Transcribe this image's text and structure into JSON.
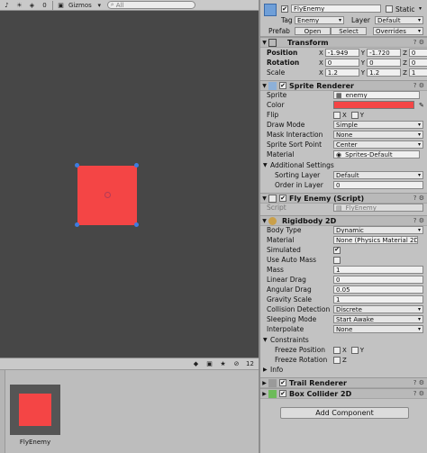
{
  "scene": {
    "toolbar": {
      "sound_icon": "♪",
      "fx_icon": "☀",
      "layers_icon": "◈",
      "layers_count": "0",
      "camera_icon": "▣",
      "gizmos_label": "Gizmos",
      "dropdown_arrow": "▾",
      "search_placeholder": "All"
    }
  },
  "project": {
    "toolbar": {
      "icons": [
        "◆",
        "▣",
        "★",
        "⊘"
      ],
      "hidden_count": "12"
    },
    "asset": {
      "name": "FlyEnemy",
      "color": "#f44545"
    }
  },
  "inspector": {
    "object_enabled": "✔",
    "object_name": "FlyEnemy",
    "static_label": "Static",
    "tag_label": "Tag",
    "tag_value": "Enemy",
    "layer_label": "Layer",
    "layer_value": "Default",
    "prefab_label": "Prefab",
    "prefab_open": "Open",
    "prefab_select": "Select",
    "prefab_overrides": "Overrides",
    "transform": {
      "title": "Transform",
      "position_label": "Position",
      "rotation_label": "Rotation",
      "scale_label": "Scale",
      "position": {
        "x": "-1.949",
        "y": "-1.720",
        "z": "0"
      },
      "rotation": {
        "x": "0",
        "y": "0",
        "z": "0"
      },
      "scale": {
        "x": "1.2",
        "y": "1.2",
        "z": "1"
      }
    },
    "sprite_renderer": {
      "title": "Sprite Renderer",
      "sprite_label": "Sprite",
      "sprite_value": "enemy",
      "color_label": "Color",
      "color_value": "#f44545",
      "flip_label": "Flip",
      "flip_x": "X",
      "flip_y": "Y",
      "draw_mode_label": "Draw Mode",
      "draw_mode_value": "Simple",
      "mask_label": "Mask Interaction",
      "mask_value": "None",
      "sort_point_label": "Sprite Sort Point",
      "sort_point_value": "Center",
      "material_label": "Material",
      "material_value": "Sprites-Default",
      "additional_label": "Additional Settings",
      "sorting_layer_label": "Sorting Layer",
      "sorting_layer_value": "Default",
      "order_label": "Order in Layer",
      "order_value": "0"
    },
    "fly_enemy": {
      "title": "Fly Enemy (Script)",
      "script_label": "Script",
      "script_value": "FlyEnemy"
    },
    "rigidbody": {
      "title": "Rigidbody 2D",
      "body_type_label": "Body Type",
      "body_type_value": "Dynamic",
      "material_label": "Material",
      "material_value": "None (Physics Material 2D",
      "simulated_label": "Simulated",
      "simulated_value": "✔",
      "auto_mass_label": "Use Auto Mass",
      "auto_mass_value": "",
      "mass_label": "Mass",
      "mass_value": "1",
      "linear_drag_label": "Linear Drag",
      "linear_drag_value": "0",
      "angular_drag_label": "Angular Drag",
      "angular_drag_value": "0.05",
      "gravity_label": "Gravity Scale",
      "gravity_value": "1",
      "collision_label": "Collision Detection",
      "collision_value": "Discrete",
      "sleeping_label": "Sleeping Mode",
      "sleeping_value": "Start Awake",
      "interpolate_label": "Interpolate",
      "interpolate_value": "None",
      "constraints_label": "Constraints",
      "freeze_pos_label": "Freeze Position",
      "freeze_rot_label": "Freeze Rotation",
      "x_label": "X",
      "y_label": "Y",
      "z_label": "Z",
      "info_label": "Info"
    },
    "trail_renderer": {
      "title": "Trail Renderer"
    },
    "box_collider": {
      "title": "Box Collider 2D"
    },
    "add_component_label": "Add Component",
    "header_icons": "? ⚙"
  }
}
